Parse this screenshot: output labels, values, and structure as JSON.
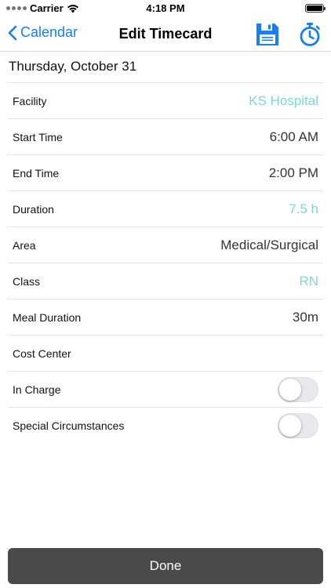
{
  "status_bar": {
    "carrier": "Carrier",
    "time": "4:18 PM"
  },
  "nav": {
    "back_label": "Calendar",
    "title": "Edit Timecard",
    "save_icon": "floppy-save-icon",
    "timer_icon": "stopwatch-icon",
    "accent_color": "#147efb"
  },
  "date_header": "Thursday, October 31",
  "fields": [
    {
      "label": "Facility",
      "value": "KS Hospital"
    },
    {
      "label": "Start Time",
      "value": "6:00 AM"
    },
    {
      "label": "End Time",
      "value": "2:00 PM"
    },
    {
      "label": "Duration",
      "value": "7.5 h"
    },
    {
      "label": "Area",
      "value": "Medical/Surgical"
    },
    {
      "label": "Class",
      "value": "RN"
    },
    {
      "label": "Meal Duration",
      "value": "30m"
    },
    {
      "label": "Cost Center",
      "value": ""
    }
  ],
  "toggles": [
    {
      "label": "In Charge",
      "on": false
    },
    {
      "label": "Special Circumstances",
      "on": false
    }
  ],
  "colors": {
    "link_value": "#7fd8d2",
    "done_button_bg": "#4a4a4a"
  },
  "done_label": "Done"
}
